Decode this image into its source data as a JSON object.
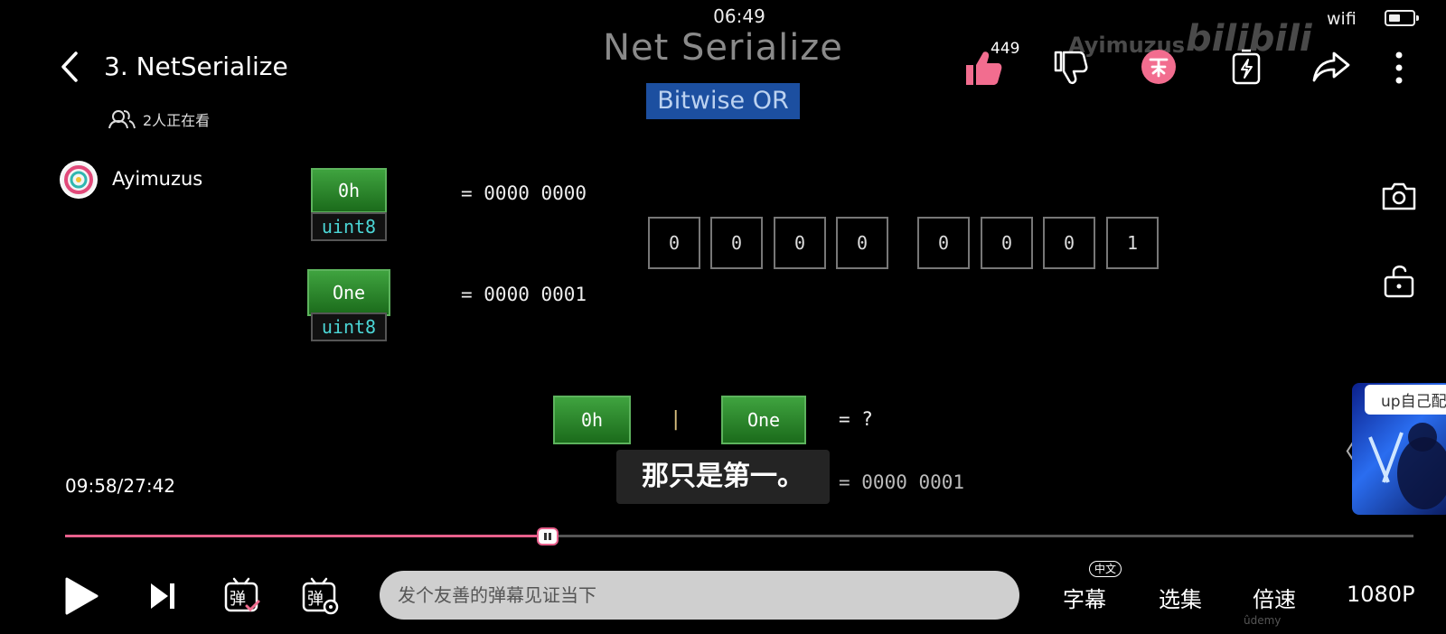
{
  "status_bar": {
    "time": "06:49",
    "network": "wifi"
  },
  "header": {
    "title": "3. NetSerialize",
    "watching": "2人正在看",
    "uploader": "Ayimuzus",
    "like_count": "449"
  },
  "slide": {
    "title": "Net Serialize",
    "subtitle": "Bitwise OR",
    "watermark_text": "Ayimuzus",
    "watermark_logo": "bilibili",
    "rows": [
      {
        "name": "0h",
        "type": "uint8",
        "equals": "= 0000 0000"
      },
      {
        "name": "One",
        "type": "uint8",
        "equals": "= 0000 0001"
      }
    ],
    "bits_high": [
      "0",
      "0",
      "0",
      "0"
    ],
    "bits_low": [
      "0",
      "0",
      "0",
      "1"
    ],
    "expression": {
      "left": "0h",
      "op": "|",
      "right": "One",
      "equals": "= ?"
    },
    "result": "= 0000 0001",
    "caption": "那只是第一。",
    "footer_mark": "ûdemy"
  },
  "player": {
    "current_time": "09:58/27:42",
    "progress_fraction": 0.358,
    "danmaku_placeholder": "发个友善的弹幕见证当下",
    "subtitle_label": "字幕",
    "subtitle_badge": "中文",
    "episodes_label": "选集",
    "speed_label": "倍速",
    "quality_label": "1080P",
    "danmaku_toggle_glyph": "弹",
    "danmaku_settings_glyph": "弹"
  },
  "recommendation": {
    "label": "up自己配"
  },
  "colors": {
    "accent": "#e8608c",
    "like": "#f26d8f",
    "coin": "#f26d8f"
  }
}
